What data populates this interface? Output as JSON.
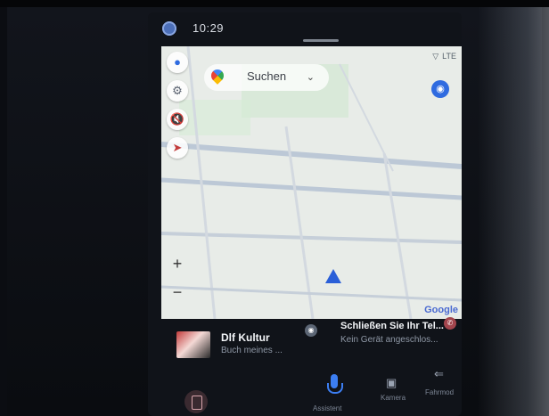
{
  "status_bar": {
    "time": "10:29",
    "network": "LTE"
  },
  "map": {
    "search_label": "Suchen",
    "attribution": "Google",
    "zoom_in": "+",
    "zoom_out": "−"
  },
  "media_card": {
    "title": "Dlf Kultur",
    "subtitle": "Buch meines ..."
  },
  "phone_card": {
    "title": "Schließen Sie Ihr Tel...",
    "subtitle": "Kein Gerät angeschlos..."
  },
  "dock": {
    "assistant_label": "Assistent",
    "camera_label": "Kamera",
    "drive_label": "Fahrmod"
  },
  "colors": {
    "accent": "#2f6be0",
    "map_bg": "#e8ece8",
    "road": "#bcc8d6",
    "park": "#cfe8cf"
  }
}
